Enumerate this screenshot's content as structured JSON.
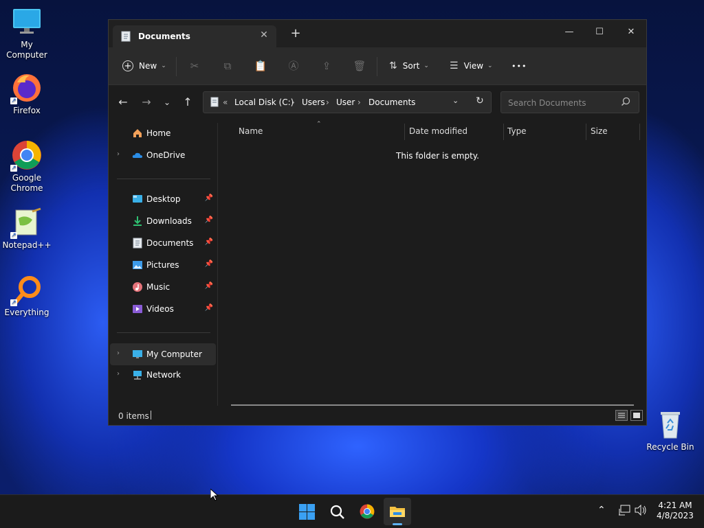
{
  "desktop": {
    "icons": [
      {
        "label": "My Computer"
      },
      {
        "label": "Firefox"
      },
      {
        "label": "Google Chrome"
      },
      {
        "label": "Notepad++"
      },
      {
        "label": "Everything"
      },
      {
        "label": "Recycle Bin"
      }
    ]
  },
  "window": {
    "tab_title": "Documents",
    "toolbar": {
      "new_label": "New",
      "sort_label": "Sort",
      "view_label": "View",
      "more_label": "•••"
    },
    "address": {
      "crumbs": [
        "Local Disk (C:)",
        "Users",
        "User",
        "Documents"
      ],
      "overflow": "«"
    },
    "search": {
      "placeholder": "Search Documents"
    },
    "sidebar": {
      "items": [
        {
          "label": "Home",
          "icon": "home-icon"
        },
        {
          "label": "OneDrive",
          "icon": "cloud-icon"
        },
        {
          "label": "Desktop",
          "icon": "desktop-icon"
        },
        {
          "label": "Downloads",
          "icon": "download-icon"
        },
        {
          "label": "Documents",
          "icon": "document-icon"
        },
        {
          "label": "Pictures",
          "icon": "picture-icon"
        },
        {
          "label": "Music",
          "icon": "music-icon"
        },
        {
          "label": "Videos",
          "icon": "video-icon"
        },
        {
          "label": "My Computer",
          "icon": "computer-icon"
        },
        {
          "label": "Network",
          "icon": "network-icon"
        }
      ]
    },
    "columns": [
      "Name",
      "Date modified",
      "Type",
      "Size"
    ],
    "empty_message": "This folder is empty.",
    "status": "0 items"
  },
  "taskbar": {
    "apps": [
      "start-icon",
      "search-icon",
      "chrome-icon",
      "file-explorer-icon"
    ],
    "clock": {
      "time": "4:21 AM",
      "date": "4/8/2023"
    }
  },
  "colors": {
    "accent": "#0078d4",
    "window_bg": "#1c1c1c",
    "toolbar_bg": "#2b2b2b",
    "taskbar_bg": "#1b1b1b"
  }
}
